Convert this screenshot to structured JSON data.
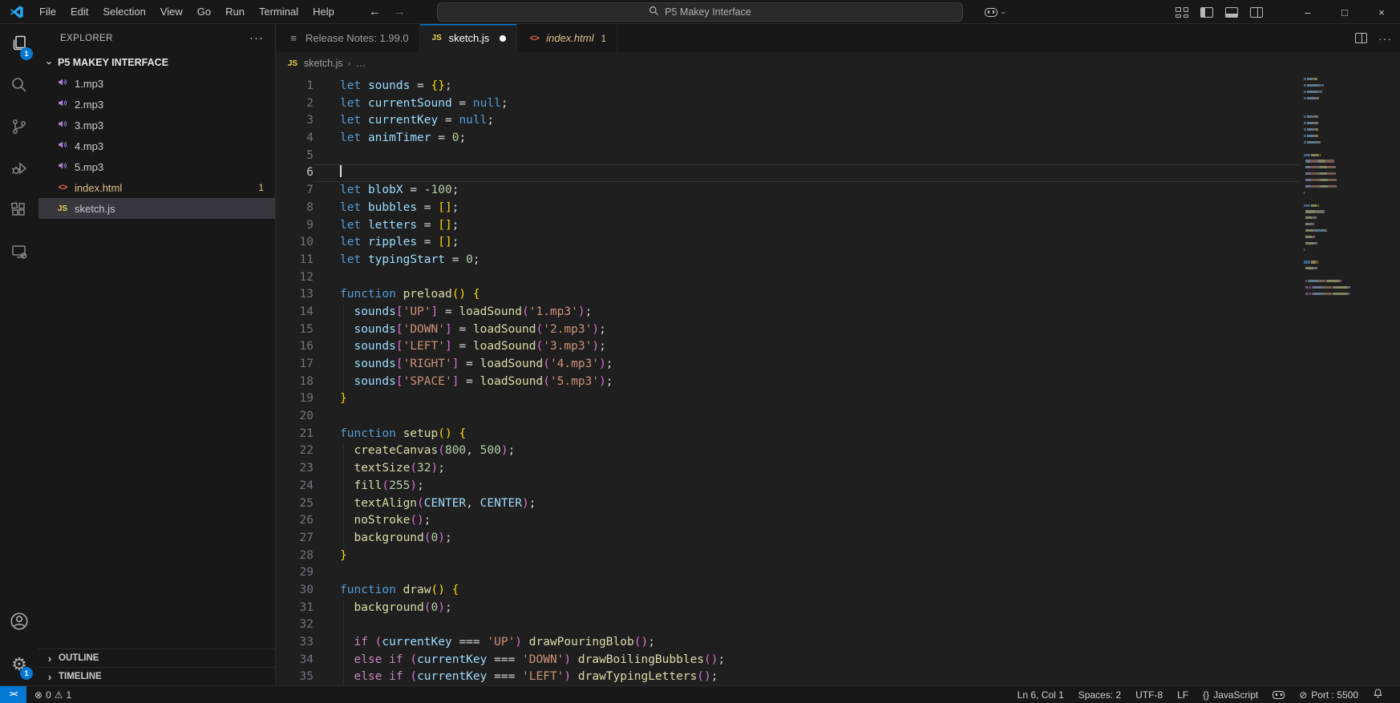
{
  "title_bar": {
    "menus": [
      "File",
      "Edit",
      "Selection",
      "View",
      "Go",
      "Run",
      "Terminal",
      "Help"
    ],
    "back_icon": "←",
    "forward_icon": "→",
    "search_text": "P5 Makey Interface",
    "window_controls": {
      "minimize": "–",
      "maximize": "□",
      "close": "×"
    }
  },
  "activity_bar": {
    "explorer_badge": "1",
    "settings_badge": "1"
  },
  "sidebar": {
    "title": "EXPLORER",
    "actions_label": "···",
    "folder": "P5 MAKEY INTERFACE",
    "files": [
      {
        "name": "1.mp3",
        "icon": "audio"
      },
      {
        "name": "2.mp3",
        "icon": "audio"
      },
      {
        "name": "3.mp3",
        "icon": "audio"
      },
      {
        "name": "4.mp3",
        "icon": "audio"
      },
      {
        "name": "5.mp3",
        "icon": "audio"
      },
      {
        "name": "index.html",
        "icon": "html",
        "badge": "1",
        "modified": true
      },
      {
        "name": "sketch.js",
        "icon": "js",
        "selected": true
      }
    ],
    "sections": [
      "OUTLINE",
      "TIMELINE"
    ]
  },
  "tabs": [
    {
      "label": "Release Notes: 1.99.0",
      "icon": "list",
      "active": false
    },
    {
      "label": "sketch.js",
      "icon": "js",
      "active": true,
      "dirty": true
    },
    {
      "label": "index.html",
      "icon": "html",
      "active": false,
      "italic": true,
      "badge": "1",
      "modified": true
    }
  ],
  "breadcrumb": {
    "file": "sketch.js",
    "sep": "›",
    "more": "…"
  },
  "code": {
    "lines": [
      {
        "n": 1,
        "tokens": [
          [
            "let",
            "kw"
          ],
          [
            " ",
            "op"
          ],
          [
            "sounds",
            "var"
          ],
          [
            " = ",
            "op"
          ],
          [
            "{}",
            "b1"
          ],
          [
            ";",
            "op"
          ]
        ]
      },
      {
        "n": 2,
        "tokens": [
          [
            "let",
            "kw"
          ],
          [
            " ",
            "op"
          ],
          [
            "currentSound",
            "var"
          ],
          [
            " = ",
            "op"
          ],
          [
            "null",
            "kw"
          ],
          [
            ";",
            "op"
          ]
        ]
      },
      {
        "n": 3,
        "tokens": [
          [
            "let",
            "kw"
          ],
          [
            " ",
            "op"
          ],
          [
            "currentKey",
            "var"
          ],
          [
            " = ",
            "op"
          ],
          [
            "null",
            "kw"
          ],
          [
            ";",
            "op"
          ]
        ]
      },
      {
        "n": 4,
        "tokens": [
          [
            "let",
            "kw"
          ],
          [
            " ",
            "op"
          ],
          [
            "animTimer",
            "var"
          ],
          [
            " = ",
            "op"
          ],
          [
            "0",
            "num"
          ],
          [
            ";",
            "op"
          ]
        ]
      },
      {
        "n": 5,
        "tokens": []
      },
      {
        "n": 6,
        "tokens": [],
        "current": true
      },
      {
        "n": 7,
        "tokens": [
          [
            "let",
            "kw"
          ],
          [
            " ",
            "op"
          ],
          [
            "blobX",
            "var"
          ],
          [
            " = ",
            "op"
          ],
          [
            "-",
            "op"
          ],
          [
            "100",
            "num"
          ],
          [
            ";",
            "op"
          ]
        ]
      },
      {
        "n": 8,
        "tokens": [
          [
            "let",
            "kw"
          ],
          [
            " ",
            "op"
          ],
          [
            "bubbles",
            "var"
          ],
          [
            " = ",
            "op"
          ],
          [
            "[]",
            "b1"
          ],
          [
            ";",
            "op"
          ]
        ]
      },
      {
        "n": 9,
        "tokens": [
          [
            "let",
            "kw"
          ],
          [
            " ",
            "op"
          ],
          [
            "letters",
            "var"
          ],
          [
            " = ",
            "op"
          ],
          [
            "[]",
            "b1"
          ],
          [
            ";",
            "op"
          ]
        ]
      },
      {
        "n": 10,
        "tokens": [
          [
            "let",
            "kw"
          ],
          [
            " ",
            "op"
          ],
          [
            "ripples",
            "var"
          ],
          [
            " = ",
            "op"
          ],
          [
            "[]",
            "b1"
          ],
          [
            ";",
            "op"
          ]
        ]
      },
      {
        "n": 11,
        "tokens": [
          [
            "let",
            "kw"
          ],
          [
            " ",
            "op"
          ],
          [
            "typingStart",
            "var"
          ],
          [
            " = ",
            "op"
          ],
          [
            "0",
            "num"
          ],
          [
            ";",
            "op"
          ]
        ]
      },
      {
        "n": 12,
        "tokens": []
      },
      {
        "n": 13,
        "tokens": [
          [
            "function",
            "kw"
          ],
          [
            " ",
            "op"
          ],
          [
            "preload",
            "fn"
          ],
          [
            "()",
            "b1"
          ],
          [
            " ",
            "op"
          ],
          [
            "{",
            "b1"
          ]
        ]
      },
      {
        "n": 14,
        "tokens": [
          [
            "  ",
            "op"
          ],
          [
            "sounds",
            "var"
          ],
          [
            "[",
            "b2"
          ],
          [
            "'UP'",
            "str"
          ],
          [
            "]",
            "b2"
          ],
          [
            " = ",
            "op"
          ],
          [
            "loadSound",
            "fn"
          ],
          [
            "(",
            "b2"
          ],
          [
            "'1.mp3'",
            "str"
          ],
          [
            ")",
            "b2"
          ],
          [
            ";",
            "op"
          ]
        ]
      },
      {
        "n": 15,
        "tokens": [
          [
            "  ",
            "op"
          ],
          [
            "sounds",
            "var"
          ],
          [
            "[",
            "b2"
          ],
          [
            "'DOWN'",
            "str"
          ],
          [
            "]",
            "b2"
          ],
          [
            " = ",
            "op"
          ],
          [
            "loadSound",
            "fn"
          ],
          [
            "(",
            "b2"
          ],
          [
            "'2.mp3'",
            "str"
          ],
          [
            ")",
            "b2"
          ],
          [
            ";",
            "op"
          ]
        ]
      },
      {
        "n": 16,
        "tokens": [
          [
            "  ",
            "op"
          ],
          [
            "sounds",
            "var"
          ],
          [
            "[",
            "b2"
          ],
          [
            "'LEFT'",
            "str"
          ],
          [
            "]",
            "b2"
          ],
          [
            " = ",
            "op"
          ],
          [
            "loadSound",
            "fn"
          ],
          [
            "(",
            "b2"
          ],
          [
            "'3.mp3'",
            "str"
          ],
          [
            ")",
            "b2"
          ],
          [
            ";",
            "op"
          ]
        ]
      },
      {
        "n": 17,
        "tokens": [
          [
            "  ",
            "op"
          ],
          [
            "sounds",
            "var"
          ],
          [
            "[",
            "b2"
          ],
          [
            "'RIGHT'",
            "str"
          ],
          [
            "]",
            "b2"
          ],
          [
            " = ",
            "op"
          ],
          [
            "loadSound",
            "fn"
          ],
          [
            "(",
            "b2"
          ],
          [
            "'4.mp3'",
            "str"
          ],
          [
            ")",
            "b2"
          ],
          [
            ";",
            "op"
          ]
        ]
      },
      {
        "n": 18,
        "tokens": [
          [
            "  ",
            "op"
          ],
          [
            "sounds",
            "var"
          ],
          [
            "[",
            "b2"
          ],
          [
            "'SPACE'",
            "str"
          ],
          [
            "]",
            "b2"
          ],
          [
            " = ",
            "op"
          ],
          [
            "loadSound",
            "fn"
          ],
          [
            "(",
            "b2"
          ],
          [
            "'5.mp3'",
            "str"
          ],
          [
            ")",
            "b2"
          ],
          [
            ";",
            "op"
          ]
        ]
      },
      {
        "n": 19,
        "tokens": [
          [
            "}",
            "b1"
          ]
        ]
      },
      {
        "n": 20,
        "tokens": []
      },
      {
        "n": 21,
        "tokens": [
          [
            "function",
            "kw"
          ],
          [
            " ",
            "op"
          ],
          [
            "setup",
            "fn"
          ],
          [
            "()",
            "b1"
          ],
          [
            " ",
            "op"
          ],
          [
            "{",
            "b1"
          ]
        ]
      },
      {
        "n": 22,
        "tokens": [
          [
            "  ",
            "op"
          ],
          [
            "createCanvas",
            "fn"
          ],
          [
            "(",
            "b2"
          ],
          [
            "800",
            "num"
          ],
          [
            ", ",
            "op"
          ],
          [
            "500",
            "num"
          ],
          [
            ")",
            "b2"
          ],
          [
            ";",
            "op"
          ]
        ]
      },
      {
        "n": 23,
        "tokens": [
          [
            "  ",
            "op"
          ],
          [
            "textSize",
            "fn"
          ],
          [
            "(",
            "b2"
          ],
          [
            "32",
            "num"
          ],
          [
            ")",
            "b2"
          ],
          [
            ";",
            "op"
          ]
        ]
      },
      {
        "n": 24,
        "tokens": [
          [
            "  ",
            "op"
          ],
          [
            "fill",
            "fn"
          ],
          [
            "(",
            "b2"
          ],
          [
            "255",
            "num"
          ],
          [
            ")",
            "b2"
          ],
          [
            ";",
            "op"
          ]
        ]
      },
      {
        "n": 25,
        "tokens": [
          [
            "  ",
            "op"
          ],
          [
            "textAlign",
            "fn"
          ],
          [
            "(",
            "b2"
          ],
          [
            "CENTER",
            "var"
          ],
          [
            ", ",
            "op"
          ],
          [
            "CENTER",
            "var"
          ],
          [
            ")",
            "b2"
          ],
          [
            ";",
            "op"
          ]
        ]
      },
      {
        "n": 26,
        "tokens": [
          [
            "  ",
            "op"
          ],
          [
            "noStroke",
            "fn"
          ],
          [
            "()",
            "b2"
          ],
          [
            ";",
            "op"
          ]
        ]
      },
      {
        "n": 27,
        "tokens": [
          [
            "  ",
            "op"
          ],
          [
            "background",
            "fn"
          ],
          [
            "(",
            "b2"
          ],
          [
            "0",
            "num"
          ],
          [
            ")",
            "b2"
          ],
          [
            ";",
            "op"
          ]
        ]
      },
      {
        "n": 28,
        "tokens": [
          [
            "}",
            "b1"
          ]
        ]
      },
      {
        "n": 29,
        "tokens": []
      },
      {
        "n": 30,
        "tokens": [
          [
            "function",
            "kw"
          ],
          [
            " ",
            "op"
          ],
          [
            "draw",
            "fn"
          ],
          [
            "()",
            "b1"
          ],
          [
            " ",
            "op"
          ],
          [
            "{",
            "b1"
          ]
        ]
      },
      {
        "n": 31,
        "tokens": [
          [
            "  ",
            "op"
          ],
          [
            "background",
            "fn"
          ],
          [
            "(",
            "b2"
          ],
          [
            "0",
            "num"
          ],
          [
            ")",
            "b2"
          ],
          [
            ";",
            "op"
          ]
        ]
      },
      {
        "n": 32,
        "tokens": []
      },
      {
        "n": 33,
        "tokens": [
          [
            "  ",
            "op"
          ],
          [
            "if",
            "ctrl"
          ],
          [
            " ",
            "op"
          ],
          [
            "(",
            "b2"
          ],
          [
            "currentKey",
            "var"
          ],
          [
            " === ",
            "op"
          ],
          [
            "'UP'",
            "str"
          ],
          [
            ")",
            "b2"
          ],
          [
            " ",
            "op"
          ],
          [
            "drawPouringBlob",
            "fn"
          ],
          [
            "()",
            "b2"
          ],
          [
            ";",
            "op"
          ]
        ]
      },
      {
        "n": 34,
        "tokens": [
          [
            "  ",
            "op"
          ],
          [
            "else",
            "ctrl"
          ],
          [
            " ",
            "op"
          ],
          [
            "if",
            "ctrl"
          ],
          [
            " ",
            "op"
          ],
          [
            "(",
            "b2"
          ],
          [
            "currentKey",
            "var"
          ],
          [
            " === ",
            "op"
          ],
          [
            "'DOWN'",
            "str"
          ],
          [
            ")",
            "b2"
          ],
          [
            " ",
            "op"
          ],
          [
            "drawBoilingBubbles",
            "fn"
          ],
          [
            "()",
            "b2"
          ],
          [
            ";",
            "op"
          ]
        ]
      },
      {
        "n": 35,
        "tokens": [
          [
            "  ",
            "op"
          ],
          [
            "else",
            "ctrl"
          ],
          [
            " ",
            "op"
          ],
          [
            "if",
            "ctrl"
          ],
          [
            " ",
            "op"
          ],
          [
            "(",
            "b2"
          ],
          [
            "currentKey",
            "var"
          ],
          [
            " === ",
            "op"
          ],
          [
            "'LEFT'",
            "str"
          ],
          [
            ")",
            "b2"
          ],
          [
            " ",
            "op"
          ],
          [
            "drawTypingLetters",
            "fn"
          ],
          [
            "()",
            "b2"
          ],
          [
            ";",
            "op"
          ]
        ]
      }
    ],
    "indent_guides": [
      {
        "from": 14,
        "to": 18
      },
      {
        "from": 22,
        "to": 27
      },
      {
        "from": 31,
        "to": 35
      }
    ]
  },
  "status_bar": {
    "errors": "0",
    "warnings": "1",
    "error_icon": "⊗",
    "warning_icon": "⚠",
    "right_segments": [
      {
        "label": "Ln 6, Col 1"
      },
      {
        "label": "Spaces: 2"
      },
      {
        "label": "UTF-8"
      },
      {
        "label": "LF"
      },
      {
        "icon": "braces",
        "icon_glyph": "{}",
        "label": "JavaScript"
      },
      {
        "icon": "copilot"
      },
      {
        "icon": "circle-slash",
        "icon_glyph": "⊘",
        "label": "Port : 5500"
      },
      {
        "icon": "bell"
      }
    ]
  },
  "colors": {
    "accent": "#0078d4",
    "modified": "#e2c08d",
    "editor_bg": "#1f1f1f",
    "chrome_bg": "#181818",
    "selection_bg": "#37373d"
  }
}
